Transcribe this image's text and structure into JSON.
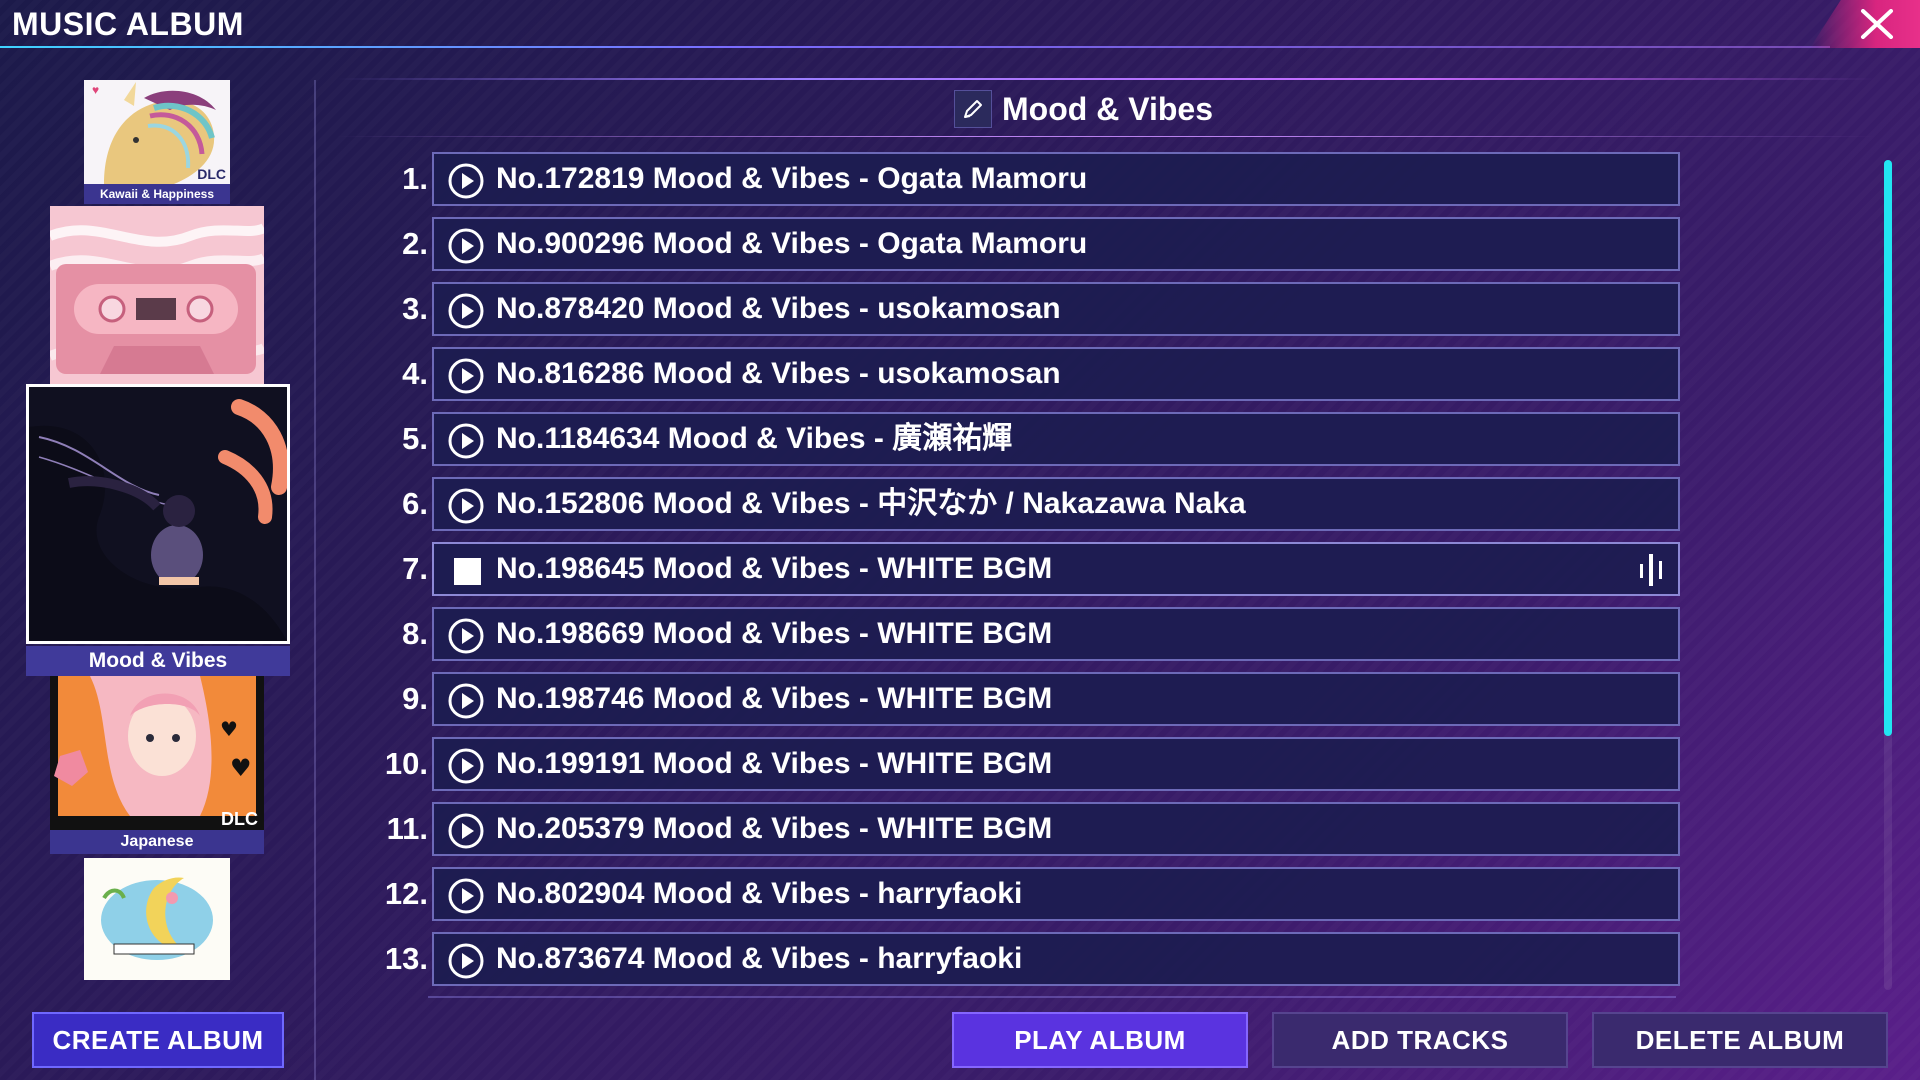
{
  "app": {
    "title": "MUSIC ALBUM",
    "close_icon": "close-icon"
  },
  "sidebar": {
    "albums": [
      {
        "label": "Kawaii & Happiness",
        "badge": "DLC",
        "selected": false
      },
      {
        "label": "",
        "badge": "",
        "selected": false
      },
      {
        "label": "Mood & Vibes",
        "badge": "",
        "selected": true
      },
      {
        "label": "Japanese",
        "badge": "DLC",
        "selected": false
      },
      {
        "label": "",
        "badge": "",
        "selected": false
      }
    ]
  },
  "album": {
    "title": "Mood & Vibes",
    "edit_icon": "pencil-icon"
  },
  "tracks": [
    {
      "num": "1.",
      "title": "No.172819 Mood & Vibes - Ogata Mamoru",
      "state": "stopped"
    },
    {
      "num": "2.",
      "title": "No.900296 Mood & Vibes - Ogata Mamoru",
      "state": "stopped"
    },
    {
      "num": "3.",
      "title": "No.878420 Mood & Vibes - usokamosan",
      "state": "stopped"
    },
    {
      "num": "4.",
      "title": "No.816286 Mood & Vibes - usokamosan",
      "state": "stopped"
    },
    {
      "num": "5.",
      "title": "No.1184634 Mood & Vibes - 廣瀬祐輝",
      "state": "stopped"
    },
    {
      "num": "6.",
      "title": "No.152806 Mood & Vibes - 中沢なか / Nakazawa Naka",
      "state": "stopped"
    },
    {
      "num": "7.",
      "title": "No.198645 Mood & Vibes - WHITE BGM",
      "state": "playing"
    },
    {
      "num": "8.",
      "title": "No.198669 Mood & Vibes - WHITE BGM",
      "state": "stopped"
    },
    {
      "num": "9.",
      "title": "No.198746 Mood & Vibes - WHITE BGM",
      "state": "stopped"
    },
    {
      "num": "10.",
      "title": "No.199191 Mood & Vibes - WHITE BGM",
      "state": "stopped"
    },
    {
      "num": "11.",
      "title": "No.205379 Mood & Vibes - WHITE BGM",
      "state": "stopped"
    },
    {
      "num": "12.",
      "title": "No.802904 Mood & Vibes - harryfaoki",
      "state": "stopped"
    },
    {
      "num": "13.",
      "title": "No.873674 Mood & Vibes - harryfaoki",
      "state": "stopped"
    }
  ],
  "buttons": {
    "create_album": "CREATE ALBUM",
    "play_album": "PLAY ALBUM",
    "add_tracks": "ADD TRACKS",
    "delete_album": "DELETE ALBUM"
  },
  "colors": {
    "accent_cyan": "#22e6f2",
    "close_pink": "#e8308a",
    "primary_button": "#5a33e0",
    "track_bg": "#1c1c50"
  }
}
